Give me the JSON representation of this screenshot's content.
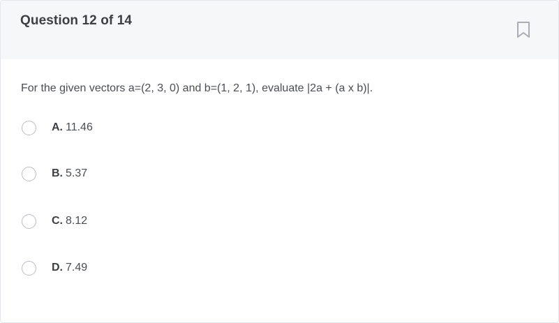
{
  "header": {
    "title": "Question 12 of 14",
    "bookmark_icon": "bookmark-icon"
  },
  "question": {
    "text": "For the given vectors a=(2, 3, 0) and b=(1, 2, 1), evaluate |2a + (a x b)|."
  },
  "options": [
    {
      "letter": "A.",
      "value": "11.46"
    },
    {
      "letter": "B.",
      "value": "5.37"
    },
    {
      "letter": "C.",
      "value": "8.12"
    },
    {
      "letter": "D.",
      "value": "7.49"
    }
  ],
  "colors": {
    "header_bg": "#f6f7f9",
    "text": "#3c4043",
    "radio_border": "#b9bdc3"
  }
}
